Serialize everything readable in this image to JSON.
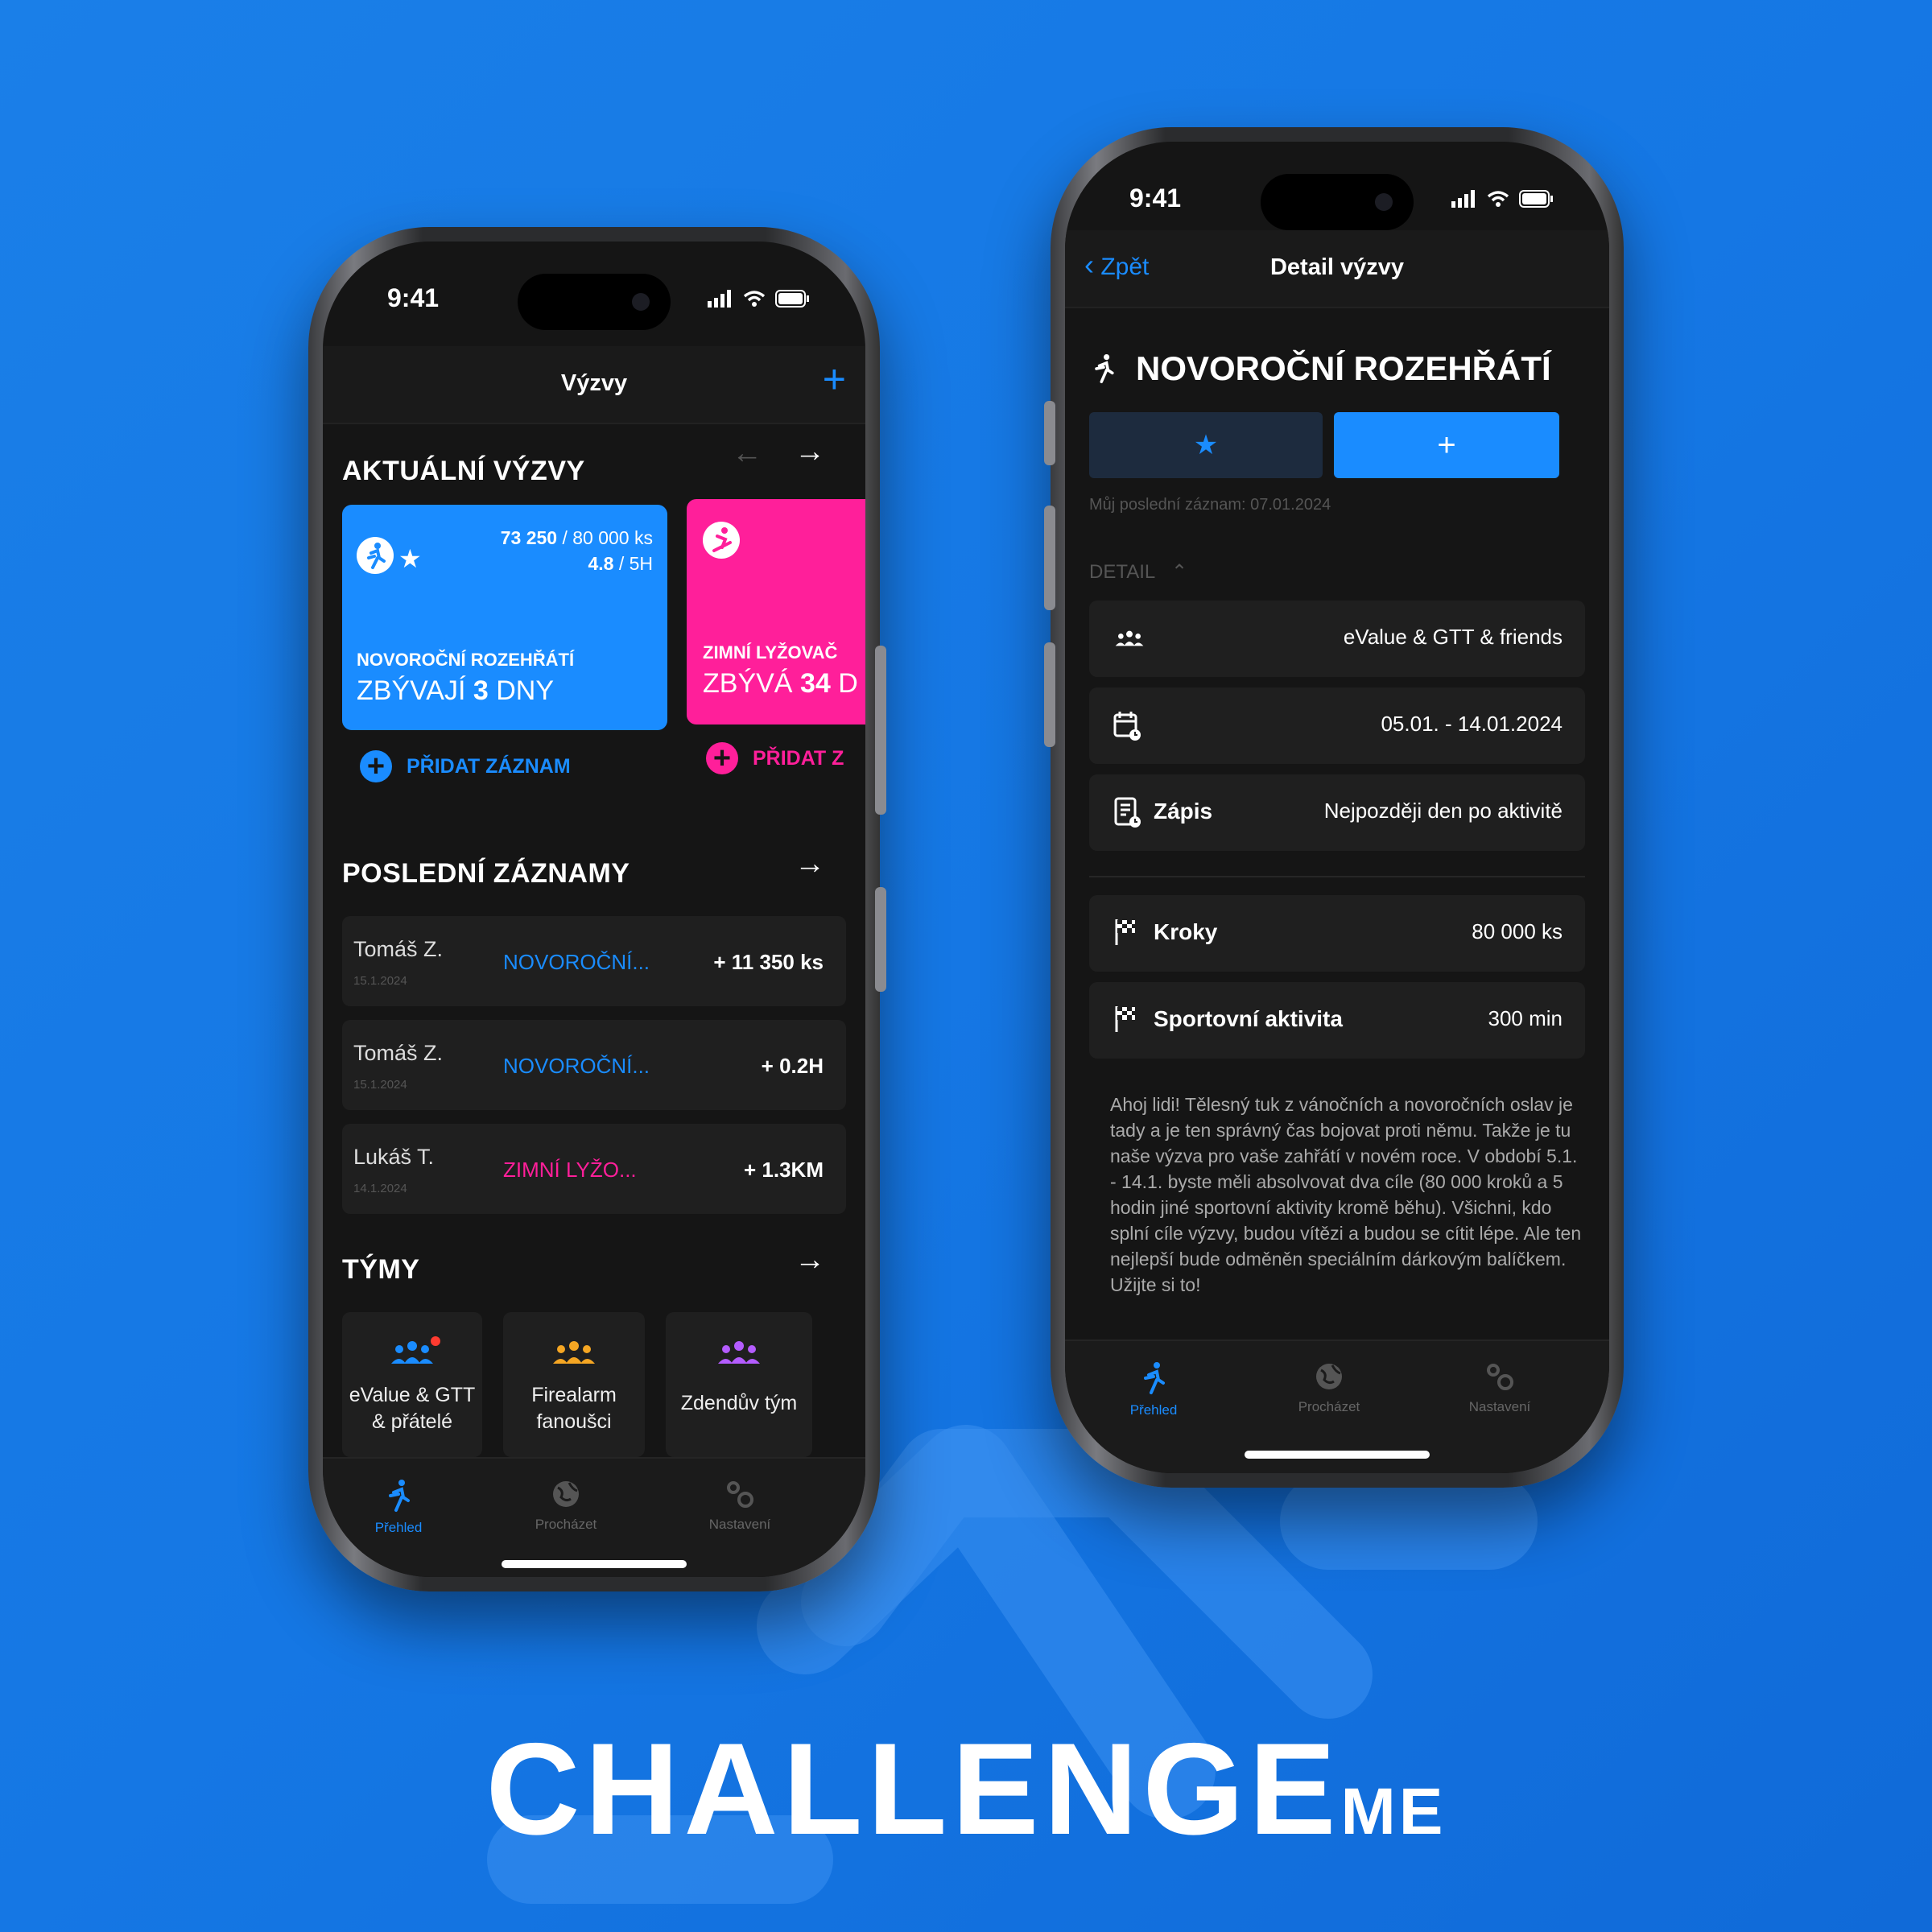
{
  "colors": {
    "accent": "#1a8cff",
    "pink": "#ff1f9a",
    "bg": "#1577e4"
  },
  "status": {
    "time": "9:41"
  },
  "left": {
    "nav_title": "Výzvy",
    "current_title": "AKTUÁLNÍ VÝZVY",
    "card1": {
      "progress_value": "73 250",
      "progress_total": "/ 80 000 ks",
      "rating": "4.8",
      "rating_total": "/ 5H",
      "name": "NOVOROČNÍ ROZEHŘÁTÍ",
      "remaining_prefix": "ZBÝVAJÍ ",
      "remaining_num": "3",
      "remaining_suffix": " DNY"
    },
    "card2": {
      "name": "ZIMNÍ LYŽOVAČ",
      "remaining_prefix": "ZBÝVÁ ",
      "remaining_num": "34",
      "remaining_suffix": " D"
    },
    "add_record": "PŘIDAT ZÁZNAM",
    "add_record2": "PŘIDAT Z",
    "records_title": "POSLEDNÍ ZÁZNAMY",
    "records": [
      {
        "name": "Tomáš Z.",
        "date": "15.1.2024",
        "challenge": "NOVOROČNÍ...",
        "value": "+ 11 350 ks"
      },
      {
        "name": "Tomáš Z.",
        "date": "15.1.2024",
        "challenge": "NOVOROČNÍ...",
        "value": "+ 0.2H"
      },
      {
        "name": "Lukáš T.",
        "date": "14.1.2024",
        "challenge": "ZIMNÍ LYŽO...",
        "value": "+ 1.3KM"
      }
    ],
    "teams_title": "TÝMY",
    "teams": [
      {
        "line1": "eValue & GTT",
        "line2": "& přátelé"
      },
      {
        "line1": "Firealarm",
        "line2": "fanoušci"
      },
      {
        "line1": "Zdendův tým",
        "line2": ""
      }
    ]
  },
  "tabs": {
    "overview": "Přehled",
    "browse": "Procházet",
    "settings": "Nastavení"
  },
  "right": {
    "back": "Zpět",
    "nav_title": "Detail výzvy",
    "challenge_title": "NOVOROČNÍ ROZEHŘÁTÍ",
    "last_record": "Můj poslední záznam: 07.01.2024",
    "detail_label": "DETAIL",
    "team": "eValue & GTT & friends",
    "dates": "05.01. - 14.01.2024",
    "entry_label": "Zápis",
    "entry_value": "Nejpozději den po aktivitě",
    "goals": [
      {
        "label": "Kroky",
        "value": "80 000 ks"
      },
      {
        "label": "Sportovní aktivita",
        "value": "300 min"
      }
    ],
    "description": "Ahoj lidi! Tělesný tuk z vánočních a novoročních oslav je tady a je ten správný čas bojovat proti němu. Takže je tu naše výzva pro vaše zahřátí v novém roce. V období 5.1. - 14.1. byste měli absolvovat dva cíle (80 000 kroků a 5 hodin jiné sportovní aktivity kromě běhu). Všichni, kdo splní cíle výzvy, budou vítězi a budou se cítit lépe. Ale ten nejlepší bude odměněn speciálním dárkovým balíčkem. Užijte si to!"
  },
  "brand": {
    "main": "CHALLENGE",
    "suffix": "ME"
  }
}
